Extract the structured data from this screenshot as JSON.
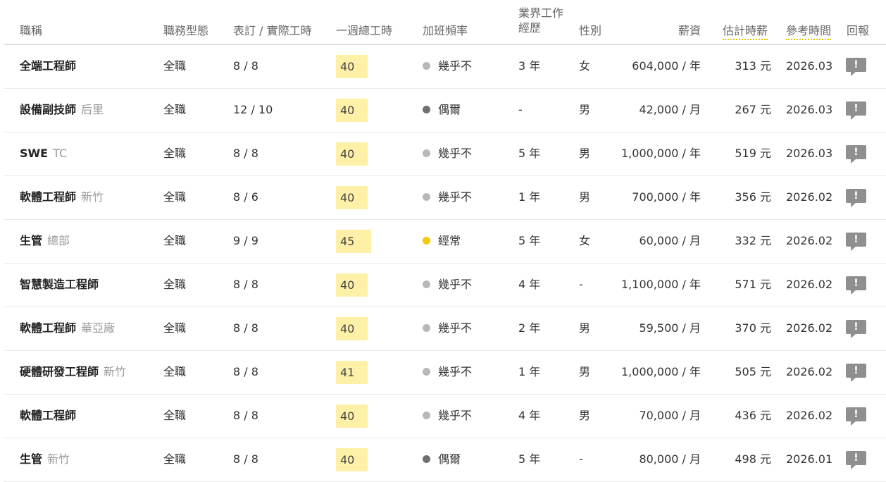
{
  "headers": {
    "job": "職稱",
    "type": "職務型態",
    "work_hours": "表訂 / 實際工時",
    "weekly": "一週總工時",
    "overtime": "加班頻率",
    "experience_line1": "業界工作",
    "experience_line2": "經歷",
    "gender": "性別",
    "salary": "薪資",
    "hourly": "估計時薪",
    "ref_time": "參考時間",
    "report": "回報"
  },
  "colors": {
    "highlight": "#fff0a8",
    "dotted_underline": "#e8c400",
    "dot_rarely": "#b8b8b8",
    "dot_sometimes": "#707070",
    "dot_often": "#f5cc00",
    "report_icon": "#8f8f8f"
  },
  "icons": {
    "report": "exclamation-speech-bubble-icon",
    "overtime": "dot-icon"
  },
  "rows": [
    {
      "title": "全端工程師",
      "location": "",
      "type": "全職",
      "hours": "8 / 8",
      "weekly": "40",
      "ot_level": "rarely",
      "ot_label": "幾乎不",
      "exp": "3 年",
      "gender": "女",
      "salary": "604,000 / 年",
      "hourly": "313 元",
      "ref": "2026.03",
      "report_mark": "!"
    },
    {
      "title": "設備副技師",
      "location": "后里",
      "type": "全職",
      "hours": "12 / 10",
      "weekly": "40",
      "ot_level": "sometimes",
      "ot_label": "偶爾",
      "exp": "-",
      "gender": "男",
      "salary": "42,000 / 月",
      "hourly": "267 元",
      "ref": "2026.03",
      "report_mark": "!"
    },
    {
      "title": "SWE",
      "location": "TC",
      "type": "全職",
      "hours": "8 / 8",
      "weekly": "40",
      "ot_level": "rarely",
      "ot_label": "幾乎不",
      "exp": "5 年",
      "gender": "男",
      "salary": "1,000,000 / 年",
      "hourly": "519 元",
      "ref": "2026.03",
      "report_mark": "!"
    },
    {
      "title": "軟體工程師",
      "location": "新竹",
      "type": "全職",
      "hours": "8 / 6",
      "weekly": "40",
      "ot_level": "rarely",
      "ot_label": "幾乎不",
      "exp": "1 年",
      "gender": "男",
      "salary": "700,000 / 年",
      "hourly": "356 元",
      "ref": "2026.02",
      "report_mark": "!"
    },
    {
      "title": "生管",
      "location": "總部",
      "type": "全職",
      "hours": "9 / 9",
      "weekly": "45",
      "ot_level": "often",
      "ot_label": "經常",
      "exp": "5 年",
      "gender": "女",
      "salary": "60,000 / 月",
      "hourly": "332 元",
      "ref": "2026.02",
      "report_mark": "!"
    },
    {
      "title": "智慧製造工程師",
      "location": "",
      "type": "全職",
      "hours": "8 / 8",
      "weekly": "40",
      "ot_level": "rarely",
      "ot_label": "幾乎不",
      "exp": "4 年",
      "gender": "-",
      "salary": "1,100,000 / 年",
      "hourly": "571 元",
      "ref": "2026.02",
      "report_mark": "!"
    },
    {
      "title": "軟體工程師",
      "location": "華亞廠",
      "type": "全職",
      "hours": "8 / 8",
      "weekly": "40",
      "ot_level": "rarely",
      "ot_label": "幾乎不",
      "exp": "2 年",
      "gender": "男",
      "salary": "59,500 / 月",
      "hourly": "370 元",
      "ref": "2026.02",
      "report_mark": "!"
    },
    {
      "title": "硬體研發工程師",
      "location": "新竹",
      "type": "全職",
      "hours": "8 / 8",
      "weekly": "41",
      "ot_level": "rarely",
      "ot_label": "幾乎不",
      "exp": "1 年",
      "gender": "男",
      "salary": "1,000,000 / 年",
      "hourly": "505 元",
      "ref": "2026.02",
      "report_mark": "!"
    },
    {
      "title": "軟體工程師",
      "location": "",
      "type": "全職",
      "hours": "8 / 8",
      "weekly": "40",
      "ot_level": "rarely",
      "ot_label": "幾乎不",
      "exp": "4 年",
      "gender": "男",
      "salary": "70,000 / 月",
      "hourly": "436 元",
      "ref": "2026.02",
      "report_mark": "!"
    },
    {
      "title": "生管",
      "location": "新竹",
      "type": "全職",
      "hours": "8 / 8",
      "weekly": "40",
      "ot_level": "sometimes",
      "ot_label": "偶爾",
      "exp": "5 年",
      "gender": "-",
      "salary": "80,000 / 月",
      "hourly": "498 元",
      "ref": "2026.01",
      "report_mark": "!"
    }
  ]
}
